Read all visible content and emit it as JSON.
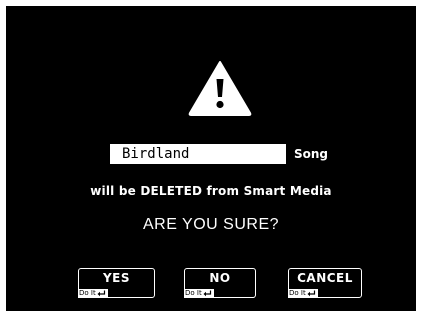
{
  "dialog": {
    "icon": "warning-icon",
    "song_name": "Birdland",
    "song_label": "Song",
    "message": "will be DELETED from Smart Media",
    "question": "ARE YOU SURE?"
  },
  "buttons": {
    "yes_label": "YES",
    "no_label": "NO",
    "cancel_label": "CANCEL",
    "doit_label": "Do It",
    "doit_icon": "enter-icon"
  },
  "colors": {
    "background": "#000000",
    "foreground": "#ffffff"
  }
}
